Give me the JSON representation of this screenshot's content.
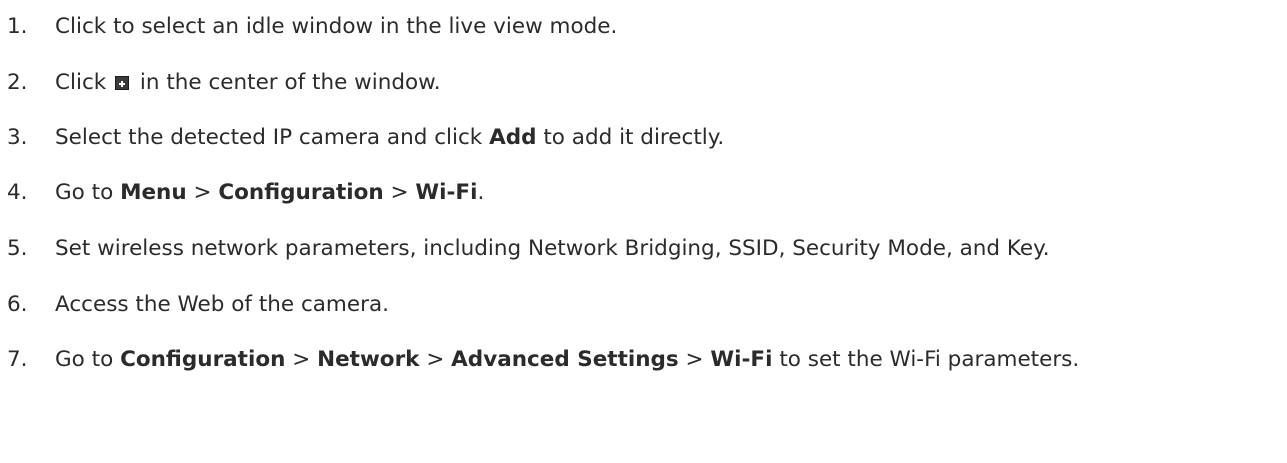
{
  "steps": [
    {
      "num": "1.",
      "parts": [
        {
          "t": "Click to select an idle window in the live view mode."
        }
      ]
    },
    {
      "num": "2.",
      "parts": [
        {
          "t": "Click "
        },
        {
          "icon": "add-icon"
        },
        {
          "t": " in the center of the window."
        }
      ]
    },
    {
      "num": "3.",
      "parts": [
        {
          "t": "Select the detected IP camera and click "
        },
        {
          "t": "Add",
          "b": true
        },
        {
          "t": " to add it directly."
        }
      ]
    },
    {
      "num": "4.",
      "parts": [
        {
          "t": "Go to "
        },
        {
          "t": "Menu",
          "b": true
        },
        {
          "t": " > "
        },
        {
          "t": "Configuration",
          "b": true
        },
        {
          "t": " > "
        },
        {
          "t": "Wi-Fi",
          "b": true
        },
        {
          "t": "."
        }
      ]
    },
    {
      "num": "5.",
      "parts": [
        {
          "t": "Set wireless network parameters, including Network Bridging, SSID, Security Mode, and Key."
        }
      ]
    },
    {
      "num": "6.",
      "parts": [
        {
          "t": "Access the Web of the camera."
        }
      ]
    },
    {
      "num": "7.",
      "parts": [
        {
          "t": "Go to "
        },
        {
          "t": "Configuration",
          "b": true
        },
        {
          "t": " > "
        },
        {
          "t": "Network",
          "b": true
        },
        {
          "t": " > "
        },
        {
          "t": "Advanced Settings",
          "b": true
        },
        {
          "t": " > "
        },
        {
          "t": "Wi-Fi",
          "b": true
        },
        {
          "t": " to set the Wi-Fi parameters."
        }
      ]
    }
  ]
}
